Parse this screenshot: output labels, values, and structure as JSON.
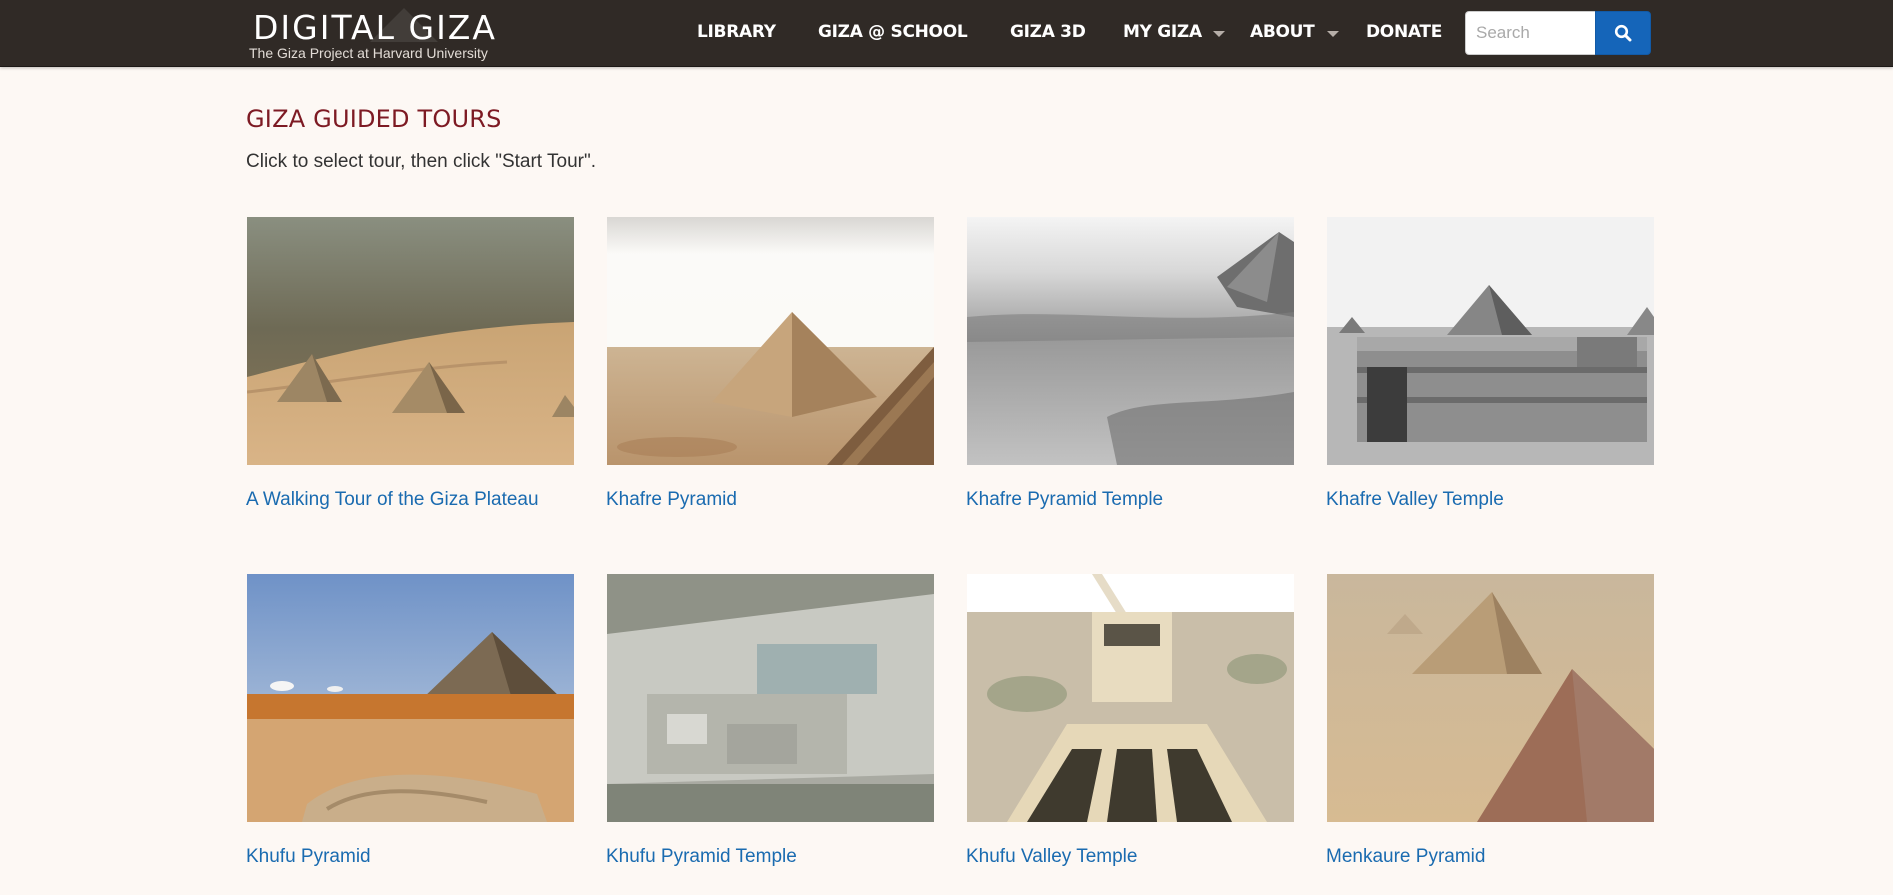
{
  "brand": {
    "title": "DIGITAL GIZA",
    "subtitle": "The Giza Project at Harvard University"
  },
  "nav": {
    "items": [
      {
        "label": "LIBRARY"
      },
      {
        "label": "GIZA @ SCHOOL"
      },
      {
        "label": "GIZA 3D"
      },
      {
        "label": "MY GIZA",
        "has_dropdown": true
      },
      {
        "label": "ABOUT",
        "has_dropdown": true
      },
      {
        "label": "DONATE"
      }
    ],
    "search": {
      "placeholder": "Search",
      "value": "",
      "button_icon": "search-icon",
      "button_color": "#1565b9"
    }
  },
  "page": {
    "title": "GIZA GUIDED TOURS",
    "instructions": "Click to select tour, then click \"Start Tour\"."
  },
  "tours": [
    {
      "label": "A Walking Tour of the Giza Plateau",
      "image": "aerial color photo of Giza pyramids with city behind"
    },
    {
      "label": "Khafre Pyramid",
      "image": "3D render of Khafre pyramid"
    },
    {
      "label": "Khafre Pyramid Temple",
      "image": "black and white photo of desert with pyramid"
    },
    {
      "label": "Khafre Valley Temple",
      "image": "black and white photo of valley temple ruins"
    },
    {
      "label": "Khufu Pyramid",
      "image": "color photo of Khufu pyramid with rocks in foreground"
    },
    {
      "label": "Khufu Pyramid Temple",
      "image": "aerial view of temple ruins"
    },
    {
      "label": "Khufu Valley Temple",
      "image": "3D render of valley temple and causeway"
    },
    {
      "label": "Menkaure Pyramid",
      "image": "3D render of Menkaure pyramid from above"
    }
  ],
  "colors": {
    "navbar_bg": "#302a26",
    "page_bg": "#fdf8f4",
    "title_color": "#7d1a23",
    "link_color": "#1a6bb0"
  }
}
